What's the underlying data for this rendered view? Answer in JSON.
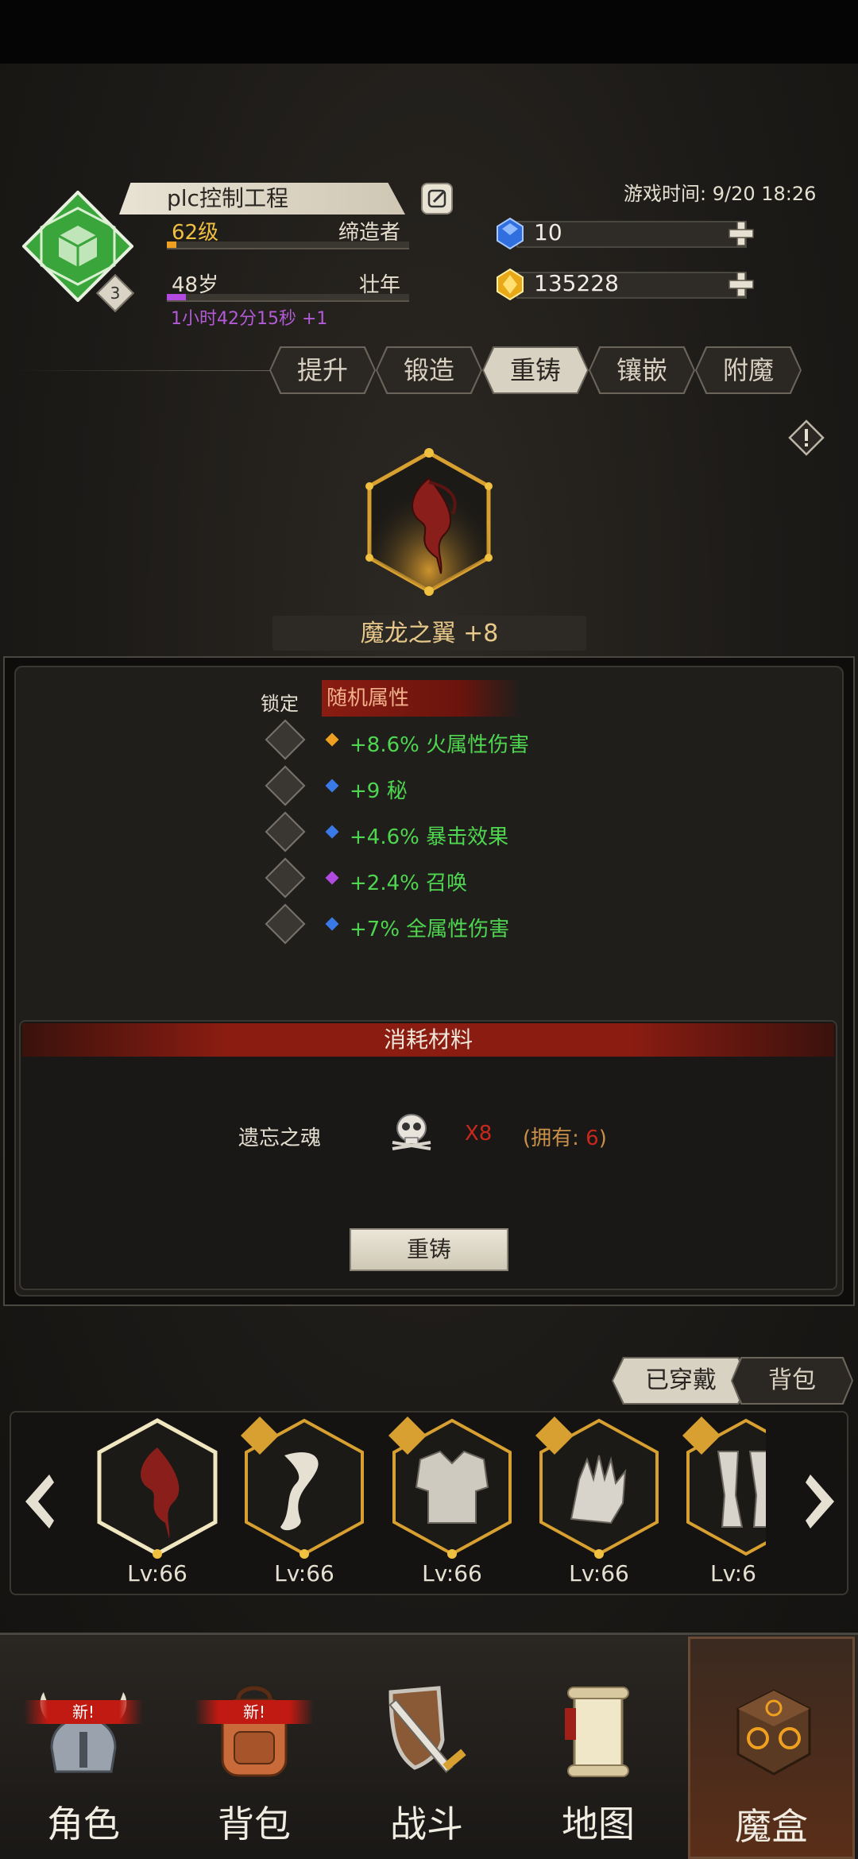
{
  "player": {
    "name": "plc控制工程",
    "level": "62级",
    "title": "缔造者",
    "level_progress": 0.04,
    "age": "48岁",
    "age_stage": "壮年",
    "age_progress": 0.08,
    "age_rate": "1小时42分15秒 +1",
    "emblem_badge": "3"
  },
  "game_time": "游戏时间: 9/20 18:26",
  "currency": {
    "diamond": "10",
    "gold": "135228"
  },
  "tabs": [
    {
      "label": "提升"
    },
    {
      "label": "锻造"
    },
    {
      "label": "重铸"
    },
    {
      "label": "镶嵌"
    },
    {
      "label": "附魔"
    }
  ],
  "active_tab": "重铸",
  "item": {
    "name": "魔龙之翼 +8"
  },
  "reforge": {
    "lock_label": "锁定",
    "random_header": "随机属性",
    "attributes": [
      {
        "text": "+8.6% 火属性伤害",
        "gem": "#f0a020"
      },
      {
        "text": "+9 秘",
        "gem": "#3a7ae8"
      },
      {
        "text": "+4.6% 暴击效果",
        "gem": "#3a7ae8"
      },
      {
        "text": "+2.4% 召唤",
        "gem": "#b04ae0"
      },
      {
        "text": "+7% 全属性伤害",
        "gem": "#3a7ae8"
      }
    ],
    "materials_header": "消耗材料",
    "material_name": "遗忘之魂",
    "material_qty": "X8",
    "material_own_prefix": "(拥有: ",
    "material_own_count": "6",
    "material_own_suffix": ")",
    "button": "重铸"
  },
  "equip_tabs": [
    {
      "label": "已穿戴"
    },
    {
      "label": "背包"
    }
  ],
  "equipment": [
    {
      "level": "Lv:66",
      "icon": "dragon-wing-icon"
    },
    {
      "level": "Lv:66",
      "icon": "scarf-icon"
    },
    {
      "level": "Lv:66",
      "icon": "armor-icon"
    },
    {
      "level": "Lv:66",
      "icon": "gauntlet-icon"
    },
    {
      "level": "Lv:6",
      "icon": "greaves-icon"
    }
  ],
  "nav": [
    {
      "label": "角色",
      "new": "新!",
      "icon": "helmet-icon"
    },
    {
      "label": "背包",
      "new": "新!",
      "icon": "backpack-icon"
    },
    {
      "label": "战斗",
      "icon": "sword-shield-icon"
    },
    {
      "label": "地图",
      "icon": "scroll-map-icon"
    },
    {
      "label": "魔盒",
      "icon": "magic-box-icon"
    }
  ],
  "colors": {
    "attr_green": "#4fd650",
    "accent_red": "#8a1c12",
    "gold": "#e8c98a"
  }
}
